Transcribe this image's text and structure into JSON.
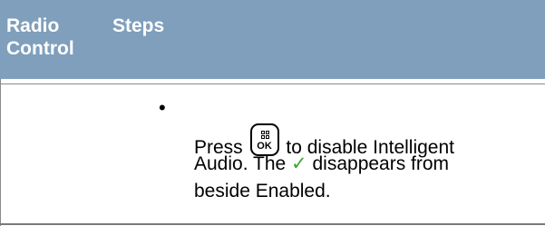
{
  "header": {
    "col1": "Radio Control",
    "col1_line1": "Radio",
    "col1_line2": "Control",
    "col2": "Steps"
  },
  "step": {
    "bullet": "•",
    "line1_before": "Press",
    "key_label": "OK",
    "line1_after": "to disable Intelligent",
    "line2_before": "Audio. The",
    "check_mark": "✓",
    "line2_after": "disappears from",
    "line3": "beside Enabled."
  },
  "colors": {
    "header_bg": "#7f9fbc",
    "header_text": "#ffffff",
    "check": "#3aa63a"
  }
}
